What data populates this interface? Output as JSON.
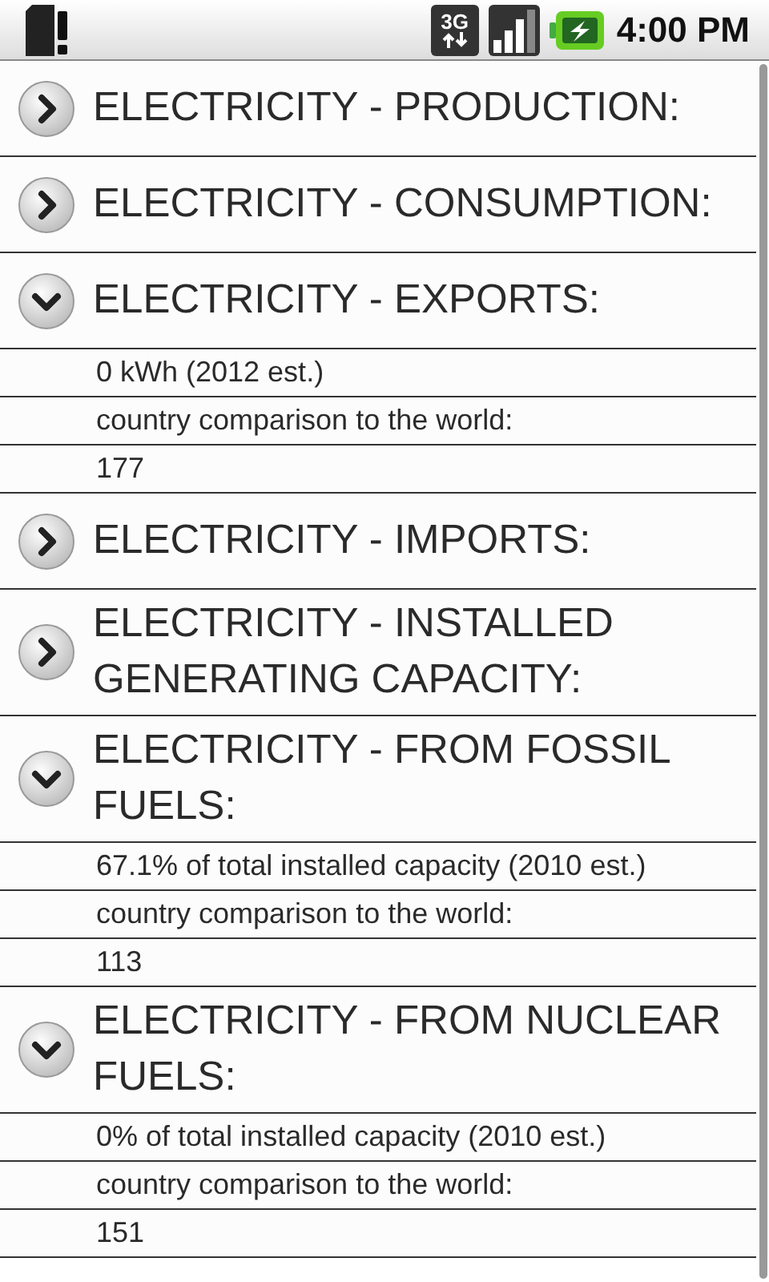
{
  "status_bar": {
    "network": "3G",
    "time": "4:00 PM"
  },
  "sections": [
    {
      "title": "ELECTRICITY - PRODUCTION:",
      "expanded": false
    },
    {
      "title": "ELECTRICITY - CONSUMPTION:",
      "expanded": false
    },
    {
      "title": "ELECTRICITY - EXPORTS:",
      "expanded": true,
      "details": [
        "0 kWh (2012 est.)",
        "country comparison to the world:",
        "177"
      ]
    },
    {
      "title": "ELECTRICITY - IMPORTS:",
      "expanded": false
    },
    {
      "title": "ELECTRICITY - INSTALLED GENERATING CAPACITY:",
      "expanded": false
    },
    {
      "title": "ELECTRICITY - FROM FOSSIL FUELS:",
      "expanded": true,
      "details": [
        "67.1% of total installed capacity (2010 est.)",
        "country comparison to the world:",
        "113"
      ]
    },
    {
      "title": "ELECTRICITY - FROM NUCLEAR FUELS:",
      "expanded": true,
      "details": [
        "0% of total installed capacity (2010 est.)",
        "country comparison to the world:",
        "151"
      ]
    }
  ]
}
